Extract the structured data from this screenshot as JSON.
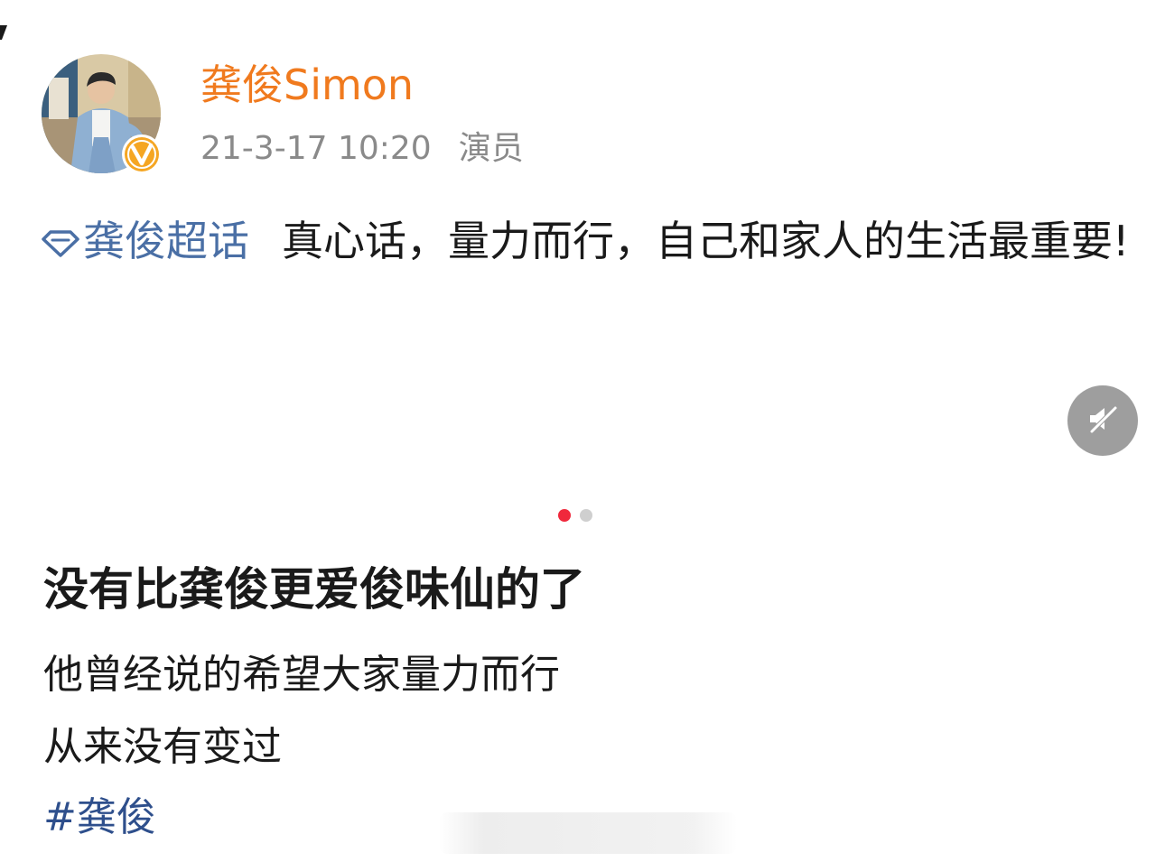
{
  "post": {
    "author": {
      "name": "龚俊Simon",
      "verified": true,
      "name_color": "#f07a1e"
    },
    "meta": {
      "timestamp": "21-3-17 10:20",
      "role": "演员"
    },
    "topic_link": "龚俊超话",
    "text": "真心话，量力而行，自己和家人的生活最重要!"
  },
  "media": {
    "mute_icon": "speaker-muted-icon",
    "carousel": {
      "count": 2,
      "active_index": 0,
      "active_color": "#f0283c"
    }
  },
  "caption": {
    "headline": "没有比龚俊更爱俊味仙的了",
    "lines": [
      "他曾经说的希望大家量力而行",
      "从来没有变过"
    ],
    "hashtag": "#龚俊"
  },
  "colors": {
    "topic": "#4a6fa5",
    "hashtag": "#2e4f8c",
    "meta": "#8a8a8a"
  }
}
